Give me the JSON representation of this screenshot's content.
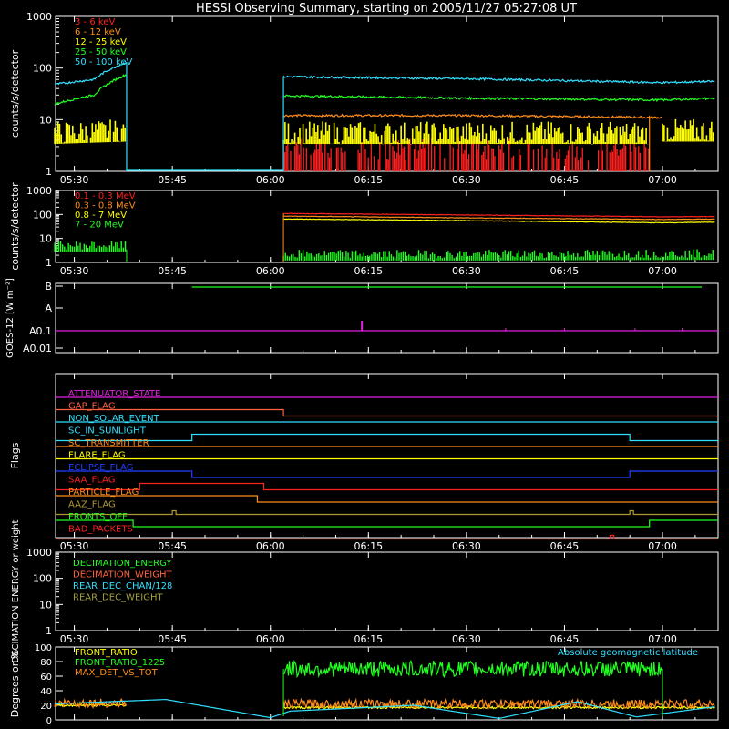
{
  "title": "HESSI Observing Summary, starting on 2005/11/27 05:27:08 UT",
  "time_ticks": [
    "05:30",
    "05:45",
    "06:00",
    "06:15",
    "06:30",
    "06:45",
    "07:00"
  ],
  "colors": {
    "white": "#ffffff",
    "red": "#ff2020",
    "orange": "#ff8c1a",
    "yellow": "#ffff00",
    "green": "#20ff20",
    "cyan": "#30e0ff",
    "magenta": "#e020e0",
    "blue": "#2040ff",
    "olive": "#b09a30",
    "salmon": "#ff6040",
    "olivegreen": "#a0a040"
  },
  "chart_data": [
    {
      "type": "line",
      "id": "rates",
      "ylabel": "counts/s/detector",
      "yscale": "log",
      "ylim": [
        1,
        1000
      ],
      "yticks": [
        "1",
        "10",
        "100",
        "1000"
      ],
      "legend": [
        "3 - 6 keV",
        "6 - 12 keV",
        "12 - 25 keV",
        "25 - 50 keV",
        "50 - 100 keV"
      ],
      "series": [
        {
          "name": "3 - 6 keV",
          "color": "red",
          "segments": [
            {
              "x": [
                "06:02",
                "06:30",
                "06:58"
              ],
              "y": [
                3,
                3,
                3
              ]
            }
          ]
        },
        {
          "name": "6 - 12 keV",
          "color": "orange",
          "segments": [
            {
              "x": [
                "06:02",
                "06:30",
                "07:00"
              ],
              "y": [
                12,
                12,
                11
              ]
            }
          ]
        },
        {
          "name": "12 - 25 keV",
          "color": "yellow",
          "segments": [
            {
              "x": [
                "05:27",
                "05:38"
              ],
              "y": [
                4.5,
                5
              ]
            },
            {
              "x": [
                "06:02",
                "06:58"
              ],
              "y": [
                4.5,
                4.5
              ]
            },
            {
              "x": [
                "07:00",
                "07:08"
              ],
              "y": [
                5,
                5
              ]
            }
          ]
        },
        {
          "name": "25 - 50 keV",
          "color": "green",
          "segments": [
            {
              "x": [
                "05:27",
                "05:33",
                "05:38"
              ],
              "y": [
                20,
                30,
                75
              ]
            },
            {
              "x": [
                "06:02",
                "06:30",
                "07:00",
                "07:08"
              ],
              "y": [
                29,
                26,
                24,
                26
              ]
            }
          ]
        },
        {
          "name": "50 - 100 keV",
          "color": "cyan",
          "segments": [
            {
              "x": [
                "05:27",
                "05:33",
                "05:38"
              ],
              "y": [
                48,
                60,
                130
              ]
            },
            {
              "x": [
                "06:02",
                "06:30",
                "07:00",
                "07:08"
              ],
              "y": [
                68,
                62,
                52,
                55
              ]
            }
          ]
        }
      ]
    },
    {
      "type": "line",
      "id": "mev",
      "ylabel": "counts/s/detector",
      "yscale": "log",
      "ylim": [
        1,
        1000
      ],
      "yticks": [
        "1",
        "10",
        "100",
        "1000"
      ],
      "legend": [
        "0.1 - 0.3 MeV",
        "0.3 - 0.8 MeV",
        "0.8 - 7 MeV",
        "7 - 20 MeV"
      ],
      "series": [
        {
          "name": "0.1 - 0.3 MeV",
          "color": "red",
          "segments": [
            {
              "x": [
                "06:02",
                "06:30",
                "07:00",
                "07:08"
              ],
              "y": [
                110,
                95,
                80,
                82
              ]
            }
          ]
        },
        {
          "name": "0.3 - 0.8 MeV",
          "color": "orange",
          "segments": [
            {
              "x": [
                "06:02",
                "06:30",
                "07:00",
                "07:08"
              ],
              "y": [
                85,
                72,
                62,
                64
              ]
            }
          ]
        },
        {
          "name": "0.8 - 7 MeV",
          "color": "yellow",
          "segments": [
            {
              "x": [
                "06:02",
                "06:30",
                "07:00",
                "07:08"
              ],
              "y": [
                65,
                55,
                45,
                48
              ]
            }
          ]
        },
        {
          "name": "7 - 20 MeV",
          "color": "green",
          "segments": [
            {
              "x": [
                "05:27",
                "05:38"
              ],
              "y": [
                3.5,
                3.5
              ]
            },
            {
              "x": [
                "06:02",
                "06:30",
                "07:08"
              ],
              "y": [
                1.5,
                1.5,
                1.6
              ]
            }
          ]
        }
      ]
    },
    {
      "type": "line",
      "id": "goes",
      "ylabel": "GOES-12 [W m⁻²]",
      "yticks": [
        "A0.01",
        "A0.1",
        "A",
        "B"
      ],
      "series": [
        {
          "name": "GOES low",
          "color": "magenta",
          "level": "A0.1",
          "spikes": [
            "06:14",
            "06:13"
          ]
        },
        {
          "name": "GOES high",
          "color": "green",
          "level": "B"
        }
      ]
    },
    {
      "type": "line",
      "id": "flags",
      "ylabel": "Flags",
      "flags": [
        {
          "name": "ATTENUATOR_STATE",
          "color": "magenta",
          "changes": []
        },
        {
          "name": "GAP_FLAG",
          "color": "salmon",
          "start": 1,
          "changes": [
            "06:02"
          ]
        },
        {
          "name": "NON_SOLAR_EVENT",
          "color": "cyan",
          "changes": []
        },
        {
          "name": "SC_IN_SUNLIGHT",
          "color": "cyan",
          "start": 0,
          "changes": [
            "05:48",
            "06:55"
          ]
        },
        {
          "name": "SC_TRANSMITTER",
          "color": "orange",
          "changes": []
        },
        {
          "name": "FLARE_FLAG",
          "color": "yellow",
          "changes": []
        },
        {
          "name": "ECLIPSE_FLAG",
          "color": "blue",
          "start": 1,
          "changes": [
            "05:48",
            "06:55"
          ]
        },
        {
          "name": "SAA_FLAG",
          "color": "red",
          "start": 0,
          "changes": [
            "05:40",
            "05:59"
          ]
        },
        {
          "name": "PARTICLE_FLAG",
          "color": "orange",
          "start": 1,
          "changes": [
            "05:58"
          ]
        },
        {
          "name": "AAZ_FLAG",
          "color": "olive",
          "start": 0,
          "pulses": [
            "05:45",
            "06:55"
          ]
        },
        {
          "name": "FRONTS_OFF",
          "color": "green",
          "start": 1,
          "changes": [
            "05:39",
            "06:58"
          ]
        },
        {
          "name": "BAD_PACKETS",
          "color": "red",
          "start": 0,
          "pulses": [
            "06:52"
          ]
        }
      ]
    },
    {
      "type": "line",
      "id": "decimation",
      "ylabel": "DECIMATION ENERGY or weight",
      "yscale": "log",
      "ylim": [
        1,
        1000
      ],
      "yticks": [
        "1",
        "10",
        "100",
        "1000"
      ],
      "legend": [
        "DECIMATION_ENERGY",
        "DECIMATION_WEIGHT",
        "REAR_DEC_CHAN/128",
        "REAR_DEC_WEIGHT"
      ]
    },
    {
      "type": "line",
      "id": "ratios",
      "ylabel": "Degrees or %",
      "ylim": [
        0,
        100
      ],
      "yticks": [
        "0",
        "20",
        "40",
        "60",
        "80",
        "100"
      ],
      "legend": [
        "FRONT_RATIO",
        "FRONT_RATIO_1225",
        "MAX_DET_VS_TOT"
      ],
      "annotation": "Absolute geomagnetic latitude",
      "series": [
        {
          "name": "FRONT_RATIO",
          "color": "yellow",
          "segments": [
            {
              "x": [
                "05:27",
                "05:38"
              ],
              "y": [
                20,
                20
              ]
            },
            {
              "x": [
                "06:02",
                "07:08"
              ],
              "y": [
                17,
                17
              ]
            }
          ]
        },
        {
          "name": "FRONT_RATIO_1225",
          "color": "green",
          "segments": [
            {
              "x": [
                "06:02",
                "06:30",
                "07:00"
              ],
              "y": [
                70,
                70,
                70
              ]
            }
          ]
        },
        {
          "name": "MAX_DET_VS_TOT",
          "color": "orange",
          "segments": [
            {
              "x": [
                "05:27",
                "05:38"
              ],
              "y": [
                23,
                23
              ]
            },
            {
              "x": [
                "06:02",
                "07:08"
              ],
              "y": [
                22,
                22
              ]
            }
          ]
        },
        {
          "name": "Absolute geomagnetic latitude",
          "color": "cyan",
          "segments": [
            {
              "x": [
                "05:27",
                "05:44",
                "06:00",
                "06:03",
                "06:22",
                "06:35",
                "06:47",
                "06:56",
                "07:08"
              ],
              "y": [
                22,
                28,
                3,
                12,
                20,
                2,
                25,
                4,
                18
              ]
            }
          ]
        }
      ]
    }
  ]
}
